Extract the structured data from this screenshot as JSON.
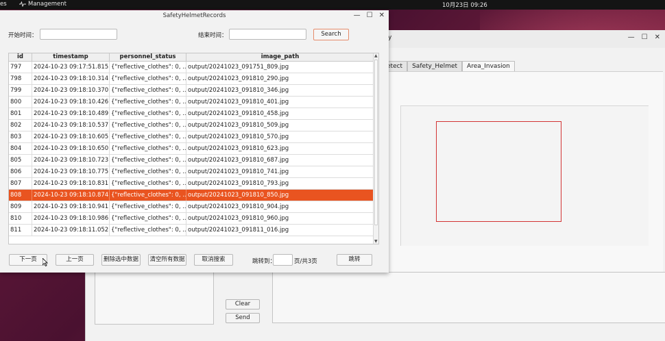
{
  "desktop": {
    "left_label": "es",
    "app_name": "Management",
    "clock": "10月23日  09:26"
  },
  "bg_window": {
    "partial_title": "y",
    "tabs": [
      "etect",
      "Safety_Helmet",
      "Area_Invasion"
    ],
    "active_tab": "Area_Invasion",
    "clear_label": "Clear",
    "send_label": "Send"
  },
  "dialog": {
    "title": "SafetyHelmetRecords",
    "start_label": "开始时间：",
    "end_label": "结束时间：",
    "search_label": "Search",
    "table": {
      "columns": [
        "id",
        "timestamp",
        "personnel_status",
        "image_path"
      ],
      "rows": [
        {
          "id": "797",
          "timestamp": "2024-10-23 09:17:51.815",
          "status": "{\"reflective_clothes\": 0, ...",
          "path": "output/20241023_091751_809.jpg"
        },
        {
          "id": "798",
          "timestamp": "2024-10-23 09:18:10.314",
          "status": "{\"reflective_clothes\": 0, ...",
          "path": "output/20241023_091810_290.jpg"
        },
        {
          "id": "799",
          "timestamp": "2024-10-23 09:18:10.370",
          "status": "{\"reflective_clothes\": 0, ...",
          "path": "output/20241023_091810_346.jpg"
        },
        {
          "id": "800",
          "timestamp": "2024-10-23 09:18:10.426",
          "status": "{\"reflective_clothes\": 0, ...",
          "path": "output/20241023_091810_401.jpg"
        },
        {
          "id": "801",
          "timestamp": "2024-10-23 09:18:10.489",
          "status": "{\"reflective_clothes\": 0, ...",
          "path": "output/20241023_091810_458.jpg"
        },
        {
          "id": "802",
          "timestamp": "2024-10-23 09:18:10.537",
          "status": "{\"reflective_clothes\": 0, ...",
          "path": "output/20241023_091810_509.jpg"
        },
        {
          "id": "803",
          "timestamp": "2024-10-23 09:18:10.605",
          "status": "{\"reflective_clothes\": 0, ...",
          "path": "output/20241023_091810_570.jpg"
        },
        {
          "id": "804",
          "timestamp": "2024-10-23 09:18:10.650",
          "status": "{\"reflective_clothes\": 0, ...",
          "path": "output/20241023_091810_623.jpg"
        },
        {
          "id": "805",
          "timestamp": "2024-10-23 09:18:10.723",
          "status": "{\"reflective_clothes\": 0, ...",
          "path": "output/20241023_091810_687.jpg"
        },
        {
          "id": "806",
          "timestamp": "2024-10-23 09:18:10.775",
          "status": "{\"reflective_clothes\": 0, ...",
          "path": "output/20241023_091810_741.jpg"
        },
        {
          "id": "807",
          "timestamp": "2024-10-23 09:18:10.831",
          "status": "{\"reflective_clothes\": 0, ...",
          "path": "output/20241023_091810_793.jpg"
        },
        {
          "id": "808",
          "timestamp": "2024-10-23 09:18:10.874",
          "status": "{\"reflective_clothes\": 0, ...",
          "path": "output/20241023_091810_850.jpg"
        },
        {
          "id": "809",
          "timestamp": "2024-10-23 09:18:10.941",
          "status": "{\"reflective_clothes\": 0, ...",
          "path": "output/20241023_091810_904.jpg"
        },
        {
          "id": "810",
          "timestamp": "2024-10-23 09:18:10.986",
          "status": "{\"reflective_clothes\": 0, ...",
          "path": "output/20241023_091810_960.jpg"
        },
        {
          "id": "811",
          "timestamp": "2024-10-23 09:18:11.052",
          "status": "{\"reflective_clothes\": 0, ...",
          "path": "output/20241023_091811_016.jpg"
        }
      ],
      "selected_id": "808"
    },
    "buttons": {
      "next_page": "下一页",
      "prev_page": "上一页",
      "delete_selected": "删除选中数据",
      "clear_all": "清空所有数据",
      "cancel_search": "取消搜索",
      "jump_to": "跳转到：",
      "page_info": "页/共3页",
      "jump": "跳转"
    }
  },
  "colors": {
    "selection": "#e95420",
    "roi": "#d23232"
  }
}
